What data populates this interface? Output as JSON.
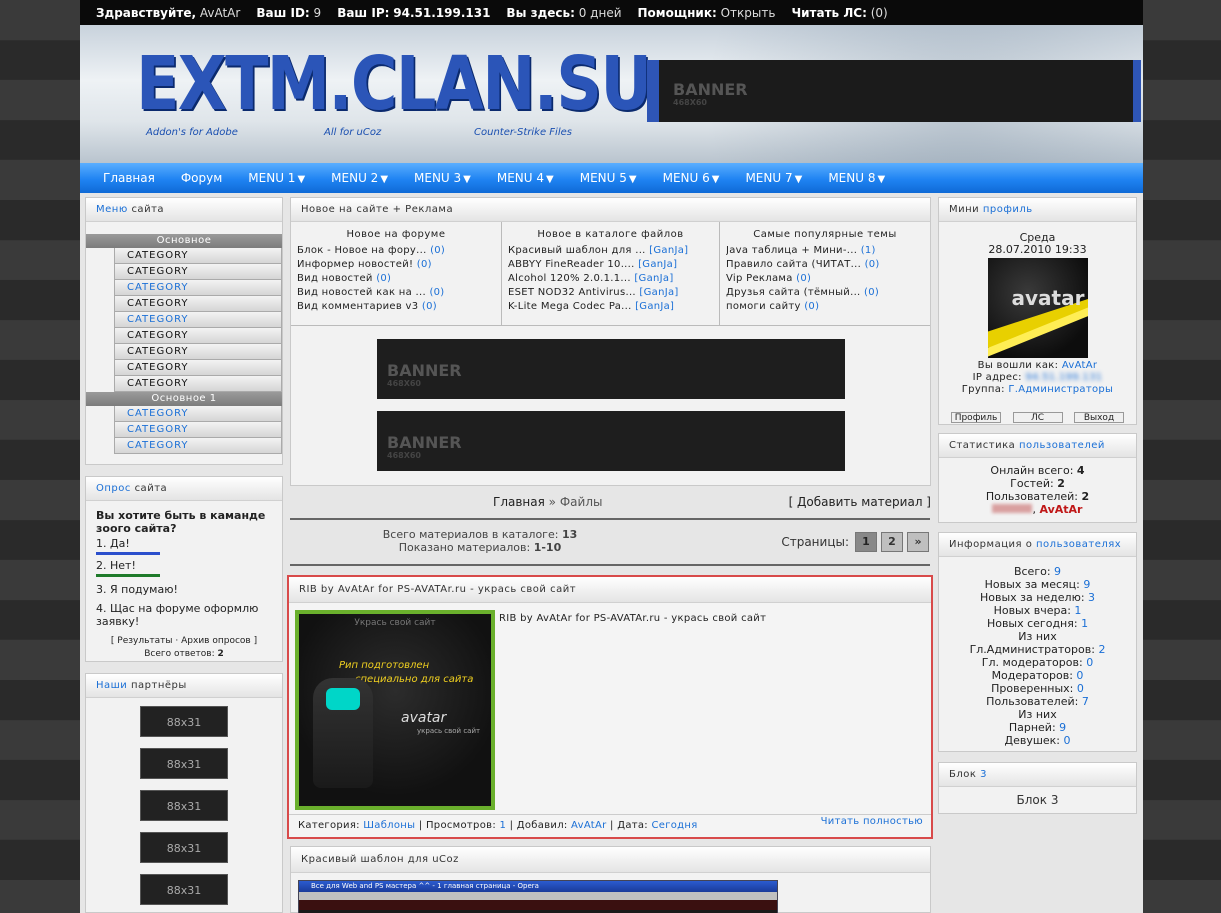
{
  "topbar": {
    "hello_label": "Здравствуйте,",
    "hello_user": "AvAtAr",
    "id_label": "Ваш ID:",
    "id_value": "9",
    "ip_label": "Ваш IP:",
    "ip_value": "94.51.199.131",
    "here_label": "Вы здесь:",
    "here_value": "0 дней",
    "helper_label": "Помощник:",
    "helper_value": "Открыть",
    "pm_label": "Читать ЛС:",
    "pm_value": "(0)"
  },
  "header": {
    "logo": "EXTM.CLAN.SU",
    "taglines": [
      "Addon's for Adobe",
      "All for uCoz",
      "Counter-Strike Files"
    ],
    "banner_title": "BANNER",
    "banner_sub": "468X60"
  },
  "nav": {
    "items": [
      {
        "label": "Главная",
        "chev": ""
      },
      {
        "label": "Форум",
        "chev": ""
      },
      {
        "label": "MENU 1",
        "chev": "▼"
      },
      {
        "label": "MENU 2",
        "chev": "▼"
      },
      {
        "label": "MENU 3",
        "chev": "▼"
      },
      {
        "label": "MENU 4",
        "chev": "▼"
      },
      {
        "label": "MENU 5",
        "chev": "▼"
      },
      {
        "label": "MENU 6",
        "chev": "▼"
      },
      {
        "label": "MENU 7",
        "chev": "▼"
      },
      {
        "label": "MENU 8",
        "chev": "▼"
      }
    ]
  },
  "left": {
    "menu_title_a": "Меню",
    "menu_title_b": "сайта",
    "group1": "Основное",
    "group1_items": [
      "CATEGORY",
      "CATEGORY",
      "CATEGORY",
      "CATEGORY",
      "CATEGORY",
      "CATEGORY",
      "CATEGORY",
      "CATEGORY",
      "CATEGORY"
    ],
    "group2": "Основное 1",
    "group2_items": [
      "CATEGORY",
      "CATEGORY",
      "CATEGORY"
    ],
    "poll_title_a": "Опрос",
    "poll_title_b": "сайта",
    "poll_question": "Вы хотите быть в каманде зоого сайта?",
    "poll_options": [
      "1. Да!",
      "2. Нет!",
      "3. Я подумаю!",
      "4. Щас на форуме оформлю заявку!"
    ],
    "poll_results": "Результаты",
    "poll_sep": "·",
    "poll_archive": "Архив опросов",
    "poll_total_label": "Всего ответов:",
    "poll_total": "2",
    "partners_title_a": "Наши",
    "partners_title_b": "партнёры",
    "partners": [
      "88x31",
      "88x31",
      "88x31",
      "88x31",
      "88x31"
    ]
  },
  "center": {
    "news_title": "Новое на сайте + Реклама",
    "col1_head": "Новое на форуме",
    "col1": [
      {
        "t": "Блок - Новое на фору...",
        "c": "(0)"
      },
      {
        "t": "Информер новостей!",
        "c": "(0)"
      },
      {
        "t": "Вид новостей",
        "c": "(0)"
      },
      {
        "t": "Вид новостей как на ...",
        "c": "(0)"
      },
      {
        "t": "Вид комментариев v3",
        "c": "(0)"
      }
    ],
    "col2_head": "Новое в каталоге файлов",
    "col2": [
      {
        "t": "Красивый шаблон для ...",
        "c": "[GanJa]"
      },
      {
        "t": "ABBYY FineReader 10....",
        "c": "[GanJa]"
      },
      {
        "t": "Alcohol 120% 2.0.1.1...",
        "c": "[GanJa]"
      },
      {
        "t": "ESET NOD32 Antivirus...",
        "c": "[GanJa]"
      },
      {
        "t": "K-Lite Mega Codec Pa...",
        "c": "[GanJa]"
      }
    ],
    "col3_head": "Самые популярные темы",
    "col3": [
      {
        "t": "Java таблица + Мини-...",
        "c": "(1)"
      },
      {
        "t": "Правило сайта (ЧИТАТ...",
        "c": "(0)"
      },
      {
        "t": "Vip Реклама",
        "c": "(0)"
      },
      {
        "t": "Друзья сайта (тёмный...",
        "c": "(0)"
      },
      {
        "t": "помоги сайту",
        "c": "(0)"
      }
    ],
    "banner_title": "BANNER",
    "banner_sub": "468X60",
    "crumb_home": "Главная",
    "crumb_sep": "»",
    "crumb_files": "Файлы",
    "add_material": "[ Добавить материал ]",
    "total_label": "Всего материалов в каталоге:",
    "total_value": "13",
    "shown_label": "Показано материалов:",
    "shown_value": "1-10",
    "pages_label": "Страницы:",
    "pages": [
      "1",
      "2",
      "»"
    ],
    "entry1_title": "RIB by AvAtAr for PS-AVATAr.ru - укрась свой сайт",
    "entry1_desc": "RIB by AvAtAr for PS-AVATAr.ru - укрась свой сайт",
    "thumb_caption_a": "Рип подготовлен",
    "thumb_caption_b": "специально для сайта",
    "thumb_logo": "avatar",
    "thumb_logo_sub": "укрась свой сайт",
    "thumb_top": "Укрась свой сайт",
    "meta_cat_label": "Категория:",
    "meta_cat": "Шаблоны",
    "meta_views_label": "Просмотров:",
    "meta_views": "1",
    "meta_added_label": "Добавил:",
    "meta_added": "AvAtAr",
    "meta_date_label": "Дата:",
    "meta_date": "Сегодня",
    "read_more": "Читать полностью",
    "entry2_title": "Красивый шаблон для uCoz",
    "entry2_window_title": "Все для Web and PS мастера ^^ - 1 главная страница - Opera"
  },
  "right": {
    "profile_title_a": "Мини",
    "profile_title_b": "профиль",
    "day": "Среда",
    "datetime": "28.07.2010 19:33",
    "avatar_text": "avatar",
    "logged_label": "Вы вошли как:",
    "logged_user": "AvAtAr",
    "ip_label": "IP адрес:",
    "ip_hidden": "94.51.199.131",
    "group_label": "Группа:",
    "group_value": "Г.Администраторы",
    "btn_profile": "Профиль",
    "btn_pm": "ЛС",
    "btn_exit": "Выход",
    "stats_title_a": "Статистика",
    "stats_title_b": "пользователей",
    "online_label": "Онлайн всего:",
    "online_value": "4",
    "guests_label": "Гостей:",
    "guests_value": "2",
    "users_label": "Пользователей:",
    "users_value": "2",
    "online_user": "AvAtAr",
    "info_title_a": "Информация о",
    "info_title_b": "пользователях",
    "info": [
      {
        "l": "Всего:",
        "v": "9"
      },
      {
        "l": "Новых за месяц:",
        "v": "9"
      },
      {
        "l": "Новых за неделю:",
        "v": "3"
      },
      {
        "l": "Новых вчера:",
        "v": "1"
      },
      {
        "l": "Новых сегодня:",
        "v": "1"
      },
      {
        "l": "Из них",
        "v": ""
      },
      {
        "l": "Гл.Администраторов:",
        "v": "2"
      },
      {
        "l": "Гл. модераторов:",
        "v": "0"
      },
      {
        "l": "Модераторов:",
        "v": "0"
      },
      {
        "l": "Проверенных:",
        "v": "0"
      },
      {
        "l": "Пользователей:",
        "v": "7"
      },
      {
        "l": "Из них",
        "v": ""
      },
      {
        "l": "Парней:",
        "v": "9"
      },
      {
        "l": "Девушек:",
        "v": "0"
      }
    ],
    "block3_title_a": "Блок",
    "block3_title_b": "3",
    "block3_body": "Блок 3"
  },
  "colors": {
    "accent": "#1a6fd6",
    "nav": "#1f83f2",
    "highlight_border": "#d84a4a"
  }
}
